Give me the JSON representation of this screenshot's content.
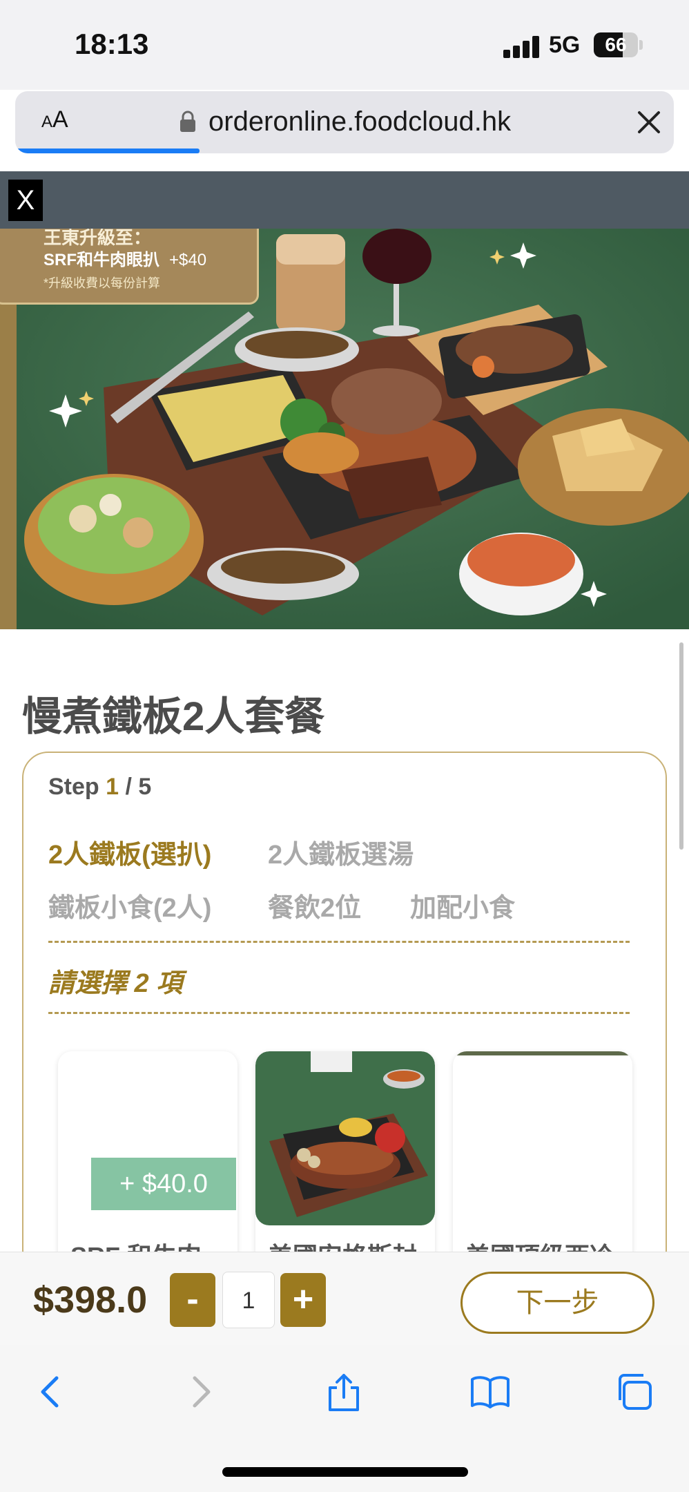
{
  "status_bar": {
    "time": "18:13",
    "network": "5G",
    "battery": "66",
    "battery_level": 0.66
  },
  "browser": {
    "font_size_button": "AA",
    "url": "orderonline.foodcloud.hk",
    "load_progress": 0.28
  },
  "banner": {
    "close_label": "X"
  },
  "hero": {
    "promo_line1": "王東升級至：",
    "promo_item": "SRF和牛肉眼扒",
    "promo_price": "+$40",
    "promo_note": "*升級收費以每份計算"
  },
  "page_title": "慢煮鐵板2人套餐",
  "steps": {
    "label": "Step",
    "current": "1",
    "total": "/ 5",
    "tabs": [
      {
        "label": "2人鐵板(選扒)",
        "active": true
      },
      {
        "label": "2人鐵板選湯",
        "active": false
      },
      {
        "label": "鐵板小食(2人)",
        "active": false
      },
      {
        "label": "餐飲2位",
        "active": false
      },
      {
        "label": "加配小食",
        "active": false
      }
    ],
    "select_hint": "請選擇 2 項"
  },
  "products": [
    {
      "name": "SRF 和牛肉",
      "surcharge": "+ $40.0"
    },
    {
      "name": "美國安格斯封"
    },
    {
      "name": "美國頂級西冷"
    }
  ],
  "order_bar": {
    "total": "$398.0",
    "minus_label": "-",
    "quantity": "1",
    "plus_label": "+",
    "next_label": "下一步"
  },
  "colors": {
    "accent": "#9b7a1f",
    "surcharge_bg": "#86c4a3",
    "banner_strip": "#4f5a63"
  }
}
